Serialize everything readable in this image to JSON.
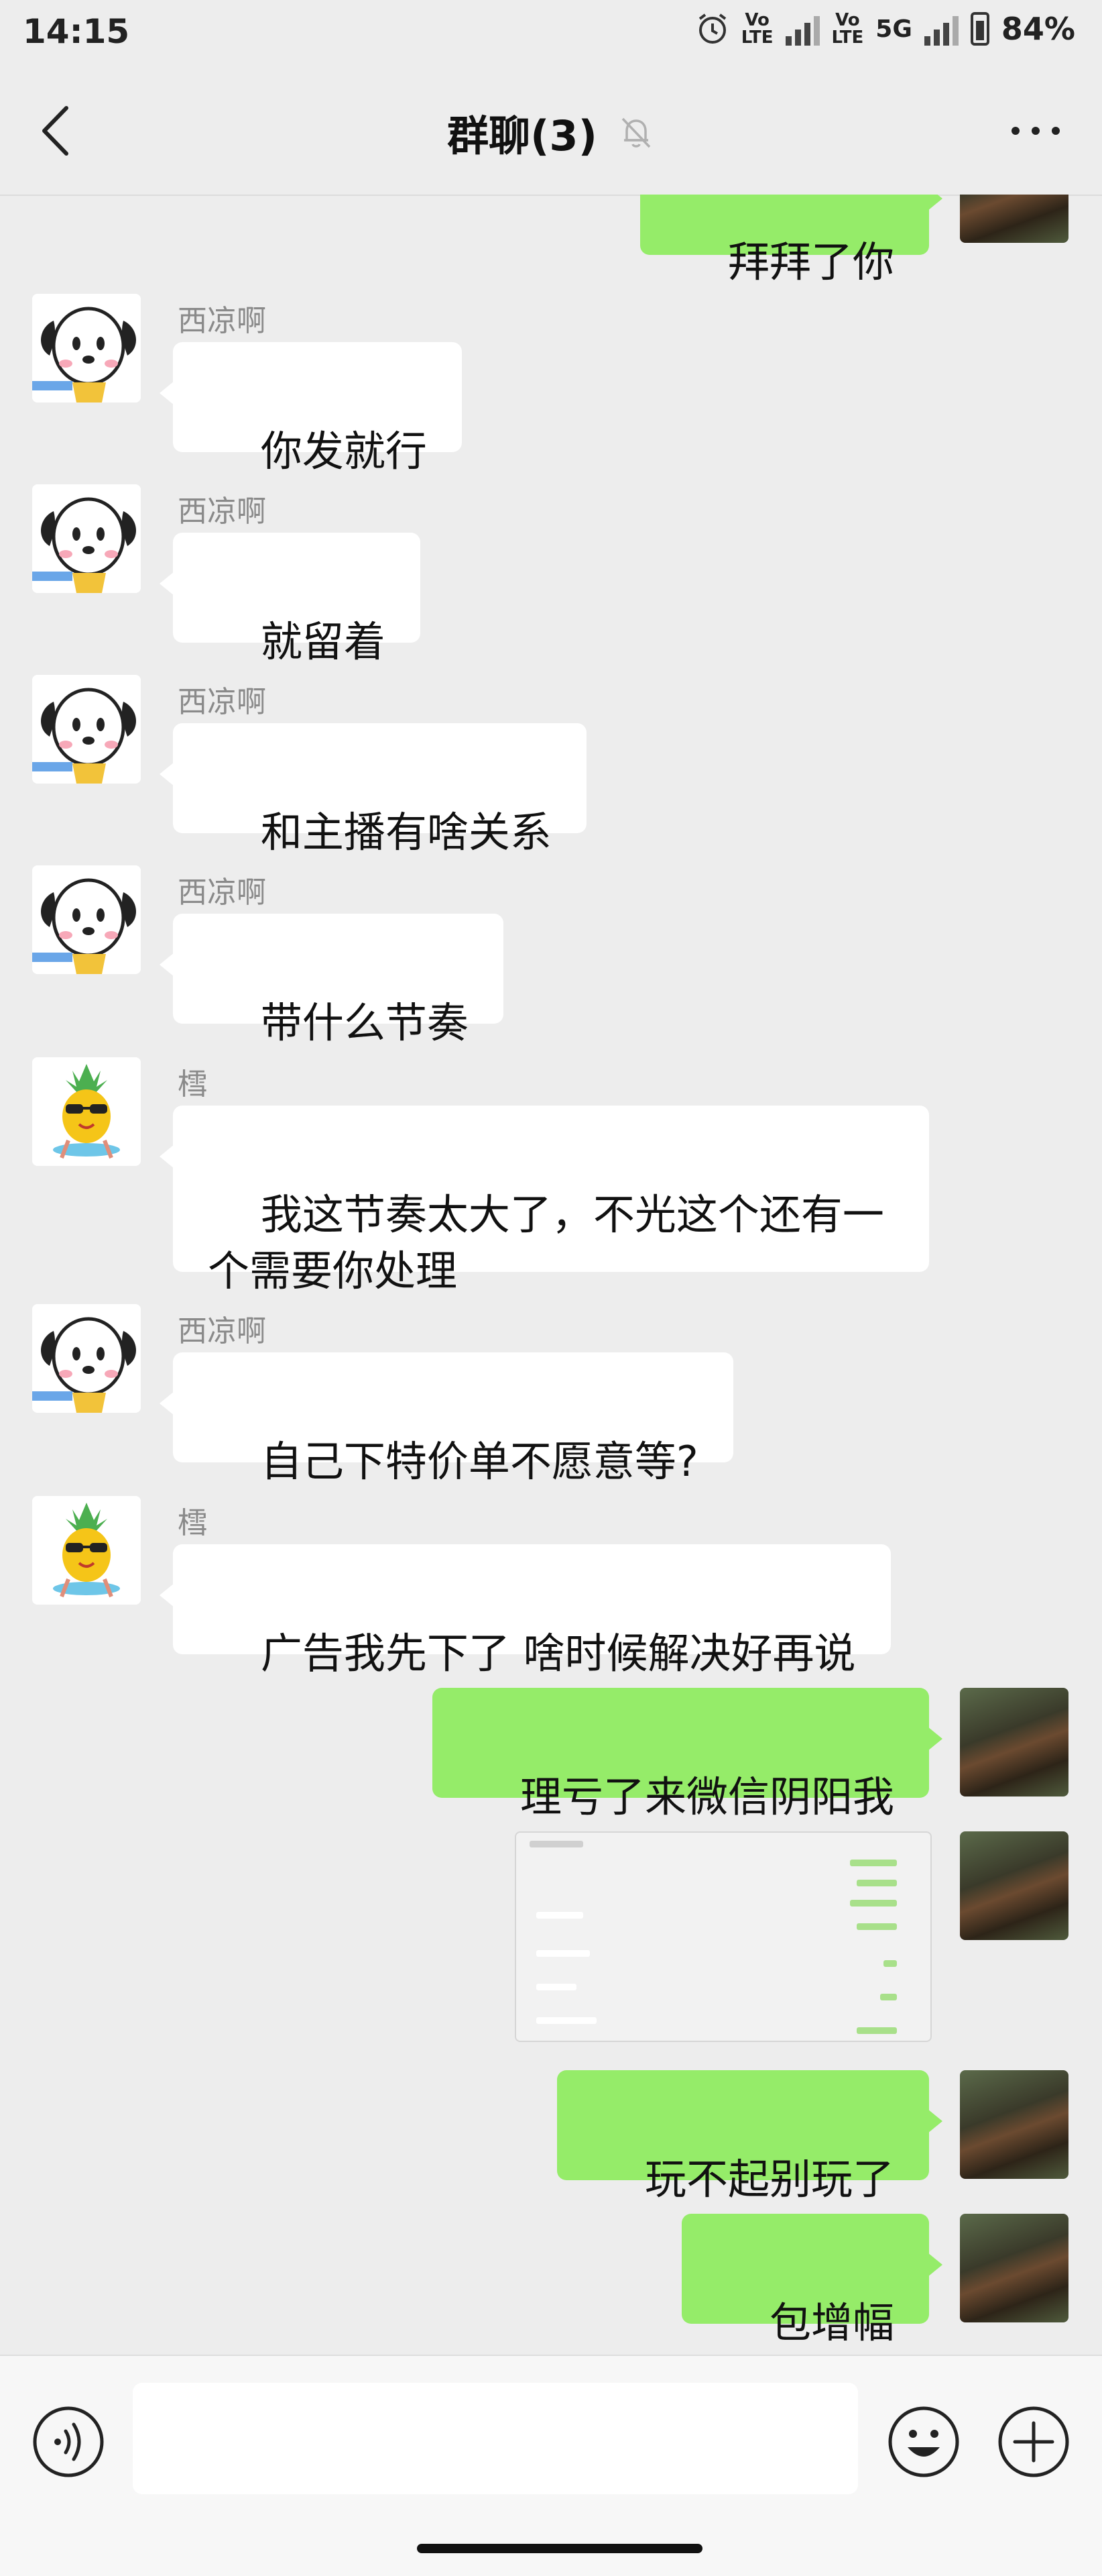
{
  "status": {
    "time": "14:15",
    "battery": "84%",
    "network": "5G",
    "volte_1": "Vo\nLTE",
    "volte_2": "Vo\nLTE"
  },
  "header": {
    "title": "群聊(3)"
  },
  "messages": [
    {
      "side": "out",
      "text": "拜拜了你",
      "avatar": "piano"
    },
    {
      "side": "in",
      "sender": "西凉啊",
      "text": "你发就行",
      "avatar": "dog"
    },
    {
      "side": "in",
      "sender": "西凉啊",
      "text": "就留着",
      "avatar": "dog"
    },
    {
      "side": "in",
      "sender": "西凉啊",
      "text": "和主播有啥关系",
      "avatar": "dog"
    },
    {
      "side": "in",
      "sender": "西凉啊",
      "text": "带什么节奏",
      "avatar": "dog"
    },
    {
      "side": "in",
      "sender": "樰",
      "text": "我这节奏太大了，不光这个还有一\n个需要你处理",
      "avatar": "pineapple"
    },
    {
      "side": "in",
      "sender": "西凉啊",
      "text": "自己下特价单不愿意等?",
      "avatar": "dog"
    },
    {
      "side": "in",
      "sender": "樰",
      "text": "广告我先下了 啥时候解决好再说",
      "avatar": "pineapple"
    },
    {
      "side": "out",
      "text": "理亏了来微信阴阳我",
      "avatar": "piano"
    },
    {
      "side": "out",
      "type": "image",
      "avatar": "piano"
    },
    {
      "side": "out",
      "text": "玩不起别玩了",
      "avatar": "piano"
    },
    {
      "side": "out",
      "text": "包增幅",
      "avatar": "piano"
    }
  ],
  "input": {
    "placeholder": ""
  }
}
